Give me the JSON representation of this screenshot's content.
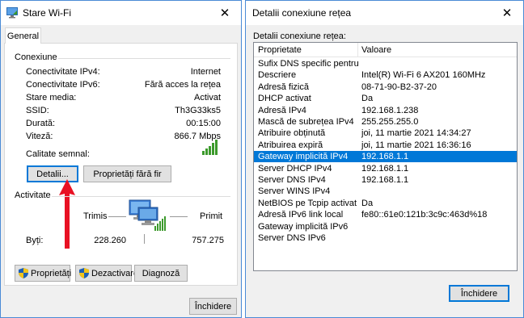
{
  "left_window": {
    "title": "Stare Wi-Fi",
    "close_glyph": "✕",
    "tab_general": "General",
    "section_connection": "Conexiune",
    "rows": [
      {
        "label": "Conectivitate IPv4:",
        "value": "Internet"
      },
      {
        "label": "Conectivitate IPv6:",
        "value": "Fără acces la rețea"
      },
      {
        "label": "Stare media:",
        "value": "Activat"
      },
      {
        "label": "SSID:",
        "value": "Th3G33ks5"
      },
      {
        "label": "Durată:",
        "value": "00:15:00"
      },
      {
        "label": "Viteză:",
        "value": "866.7 Mbps"
      }
    ],
    "signal_label": "Calitate semnal:",
    "signal_bars": 5,
    "details_button": "Detalii...",
    "wireless_props_button": "Proprietăți fără fir",
    "section_activity": "Activitate",
    "sent_label": "Trimis",
    "received_label": "Primit",
    "bytes_label": "Byți:",
    "bytes_sent": "228.260",
    "bytes_received": "757.275",
    "properties_button": "Proprietăți",
    "disable_button": "Dezactivare",
    "diagnose_button": "Diagnoză",
    "close_button": "Închidere"
  },
  "right_window": {
    "title": "Detalii conexiune rețea",
    "close_glyph": "✕",
    "section_label": "Detalii conexiune rețea:",
    "columns": [
      "Proprietate",
      "Valoare"
    ],
    "selected_index": 8,
    "rows": [
      {
        "property": "Sufix DNS specific pentru c...",
        "value": ""
      },
      {
        "property": "Descriere",
        "value": "Intel(R) Wi-Fi 6 AX201 160MHz"
      },
      {
        "property": "Adresă fizică",
        "value": "08-71-90-B2-37-20"
      },
      {
        "property": "DHCP activat",
        "value": "Da"
      },
      {
        "property": "Adresă IPv4",
        "value": "192.168.1.238"
      },
      {
        "property": "Mască de subrețea IPv4",
        "value": "255.255.255.0"
      },
      {
        "property": "Atribuire obținută",
        "value": "joi, 11 martie 2021 14:34:27"
      },
      {
        "property": "Atribuirea expiră",
        "value": "joi, 11 martie 2021 16:36:16"
      },
      {
        "property": "Gateway implicită IPv4",
        "value": "192.168.1.1"
      },
      {
        "property": "Server DHCP IPv4",
        "value": "192.168.1.1"
      },
      {
        "property": "Server DNS IPv4",
        "value": "192.168.1.1"
      },
      {
        "property": "Server WINS IPv4",
        "value": ""
      },
      {
        "property": "NetBIOS pe Tcpip activat",
        "value": "Da"
      },
      {
        "property": "Adresă IPv6 link local",
        "value": "fe80::61e0:121b:3c9c:463d%18"
      },
      {
        "property": "Gateway implicită IPv6",
        "value": ""
      },
      {
        "property": "Server DNS IPv6",
        "value": ""
      }
    ],
    "close_button": "Închidere"
  },
  "colors": {
    "accent": "#0078d7",
    "signal_green": "#3c9a2c",
    "annotation_arrow": "#e81123",
    "window_border": "#4a8bd6"
  }
}
